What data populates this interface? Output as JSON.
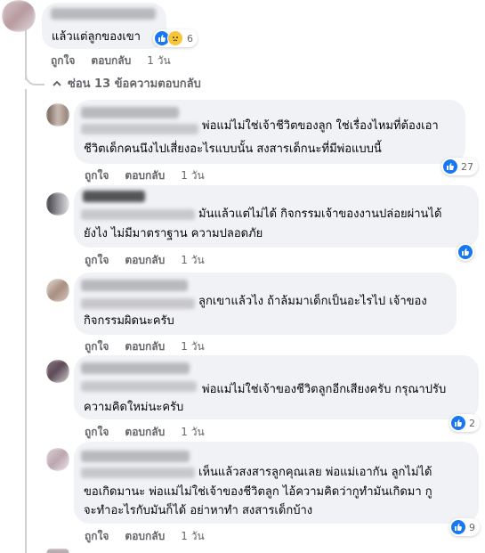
{
  "top_comment": {
    "text": "แล้วแต่ลูกของเขา",
    "reaction_count": "6",
    "actions": {
      "like": "ถูกใจ",
      "reply": "ตอบกลับ",
      "time": "1 วัน"
    }
  },
  "hide_replies": {
    "label": "ซ่อน 13 ข้อความตอบกลับ",
    "icon": "chevron-up-icon"
  },
  "replies": [
    {
      "line1": "พ่อแม่ไม่ใช่เจ้าชีวิตของลูก ใช่เรื่องไหมที่ต้องเอา",
      "line2": "ชีวิตเด็กคนนึงไปเสี่ยงอะไรแบบนั้น สงสารเด็กนะที่มีพ่อแบบนี้",
      "reaction_count": "27",
      "actions": {
        "like": "ถูกใจ",
        "reply": "ตอบกลับ",
        "time": "1 วัน"
      }
    },
    {
      "line1": "มันแล้วแต่ไม่ได้ กิจกรรมเจ้าของงานปล่อยผ่านได้",
      "line2": "ยังไง ไม่มีมาตราฐาน ความปลอดภัย",
      "reaction_count": "",
      "actions": {
        "like": "ถูกใจ",
        "reply": "ตอบกลับ",
        "time": "1 วัน"
      }
    },
    {
      "line1": "ลูกเขาแล้วไง ถ้าล้มมาเด็กเป็นอะไรไป เจ้าของ",
      "line2": "กิจกรรมผิดนะครับ",
      "reaction_count": "",
      "actions": {
        "like": "ถูกใจ",
        "reply": "ตอบกลับ",
        "time": "1 วัน"
      }
    },
    {
      "line1": "พ่อแม่ไม่ใช่เจ้าของชีวิตลูกอีกเสียงครับ กรุณาปรับ",
      "line2": "ความคิดใหม่นะครับ",
      "reaction_count": "2",
      "actions": {
        "like": "ถูกใจ",
        "reply": "ตอบกลับ",
        "time": "1 วัน"
      }
    },
    {
      "line1": "เห็นแล้วสงสารลูกคุณเลย พ่อแม่เอากัน ลูกไม่ได้",
      "line2": "ขอเกิดมานะ พ่อแม่ไม่ใช่เจ้าของชีวิตลูก ไอ้ความคิดว่ากูทำมันเกิดมา กู",
      "line3": "จะทำอะไรกับมันก็ได้ อย่าหาทำ สงสารเด็กบ้าง",
      "reaction_count": "9",
      "actions": {
        "like": "ถูกใจ",
        "reply": "ตอบกลับ",
        "time": "1 วัน"
      }
    }
  ],
  "colors": {
    "bubble": "#f0f2f5",
    "meta": "#65676b",
    "like_blue": "#1877f2",
    "thread_line": "#ced0d4"
  }
}
